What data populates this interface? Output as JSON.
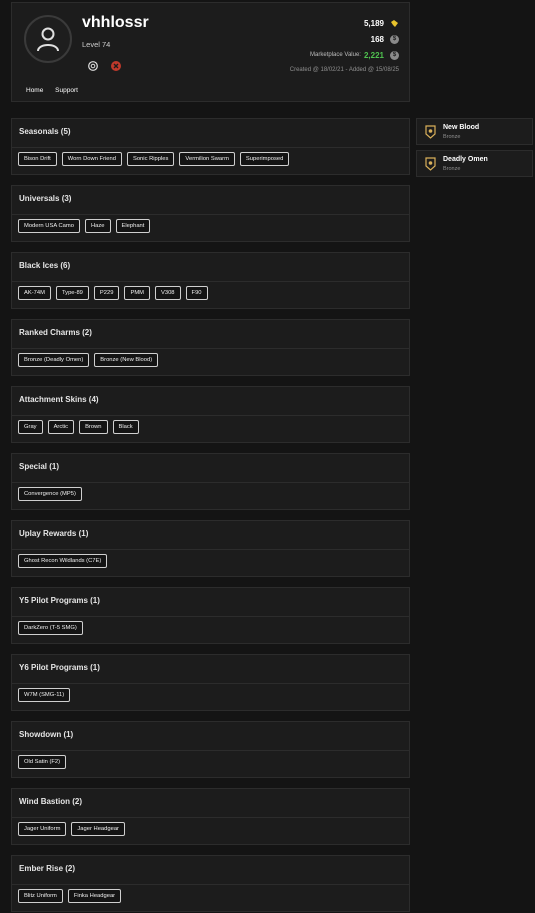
{
  "profile": {
    "username": "vhhlossr",
    "level": "Level 74",
    "renown": "5,189",
    "credits": "168",
    "marketplace_label": "Marketplace Value:",
    "marketplace_value": "2,221",
    "created": "Created @ 18/02/21 - Added @ 15/08/25",
    "colors": {
      "accent_green": "#4fc24f",
      "renown_yellow": "#e8c32c",
      "xbox_red": "#c0392b"
    }
  },
  "nav": {
    "home": "Home",
    "support": "Support"
  },
  "sections": [
    {
      "title": "Seasonals (5)",
      "items": [
        "Bison Drift",
        "Worn Down Friend",
        "Sonic Ripples",
        "Vermilion Swarm",
        "Superimposed"
      ]
    },
    {
      "title": "Universals (3)",
      "items": [
        "Modern USA Camo",
        "Haze",
        "Elephant"
      ]
    },
    {
      "title": "Black Ices (6)",
      "items": [
        "AK-74M",
        "Type-89",
        "P229",
        "PMM",
        "V308",
        "F90"
      ]
    },
    {
      "title": "Ranked Charms (2)",
      "items": [
        "Bronze (Deadly Omen)",
        "Bronze (New Blood)"
      ]
    },
    {
      "title": "Attachment Skins (4)",
      "items": [
        "Gray",
        "Arctic",
        "Brown",
        "Black"
      ]
    },
    {
      "title": "Special (1)",
      "items": [
        "Convergence (MP5)"
      ]
    },
    {
      "title": "Uplay Rewards (1)",
      "items": [
        "Ghost Recon Wildlands (C7E)"
      ]
    },
    {
      "title": "Y5 Pilot Programs (1)",
      "items": [
        "DarkZero (T-5 SMG)"
      ]
    },
    {
      "title": "Y6 Pilot Programs (1)",
      "items": [
        "W7M (SMG-11)"
      ]
    },
    {
      "title": "Showdown (1)",
      "items": [
        "Old Satin (F2)"
      ]
    },
    {
      "title": "Wind Bastion (2)",
      "items": [
        "Jager Uniform",
        "Jager Headgear"
      ]
    },
    {
      "title": "Ember Rise (2)",
      "items": [
        "Blitz Uniform",
        "Finka Headgear"
      ]
    }
  ],
  "charms": [
    {
      "name": "New Blood",
      "rank": "Bronze",
      "icon": "charm-badge-icon"
    },
    {
      "name": "Deadly Omen",
      "rank": "Bronze",
      "icon": "charm-badge-icon"
    }
  ]
}
